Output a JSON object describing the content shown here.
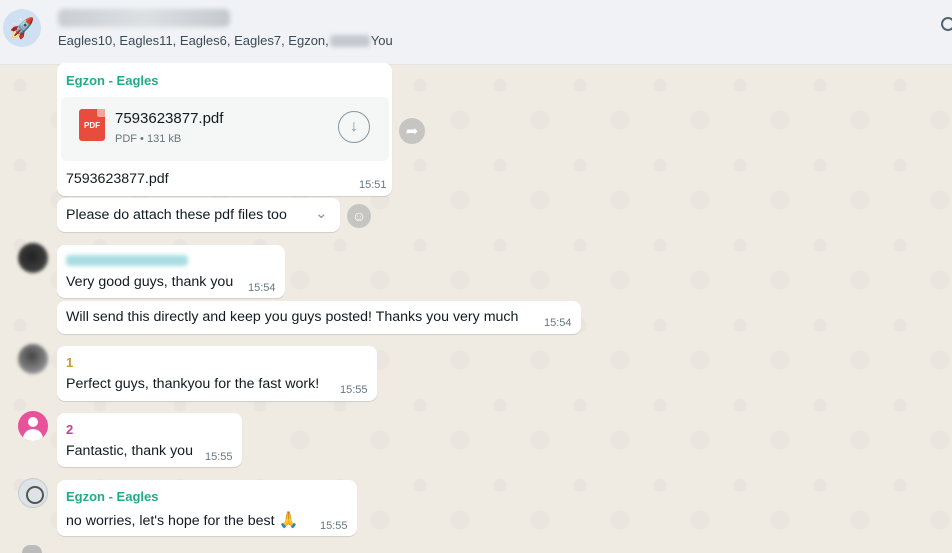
{
  "header": {
    "participants_prefix": "Eagles10, Eagles11, Eagles6, Eagles7, Egzon,",
    "participants_suffix": "You",
    "avatar_icon": "rocket-icon",
    "avatar_emoji": "🚀"
  },
  "messages": [
    {
      "sender": "Egzon - Eagles",
      "sender_color": "#25a98b",
      "document": {
        "name": "7593623877.pdf",
        "type_label": "PDF",
        "meta": "PDF • 131 kB"
      },
      "caption": "7593623877.pdf",
      "time": "15:51"
    },
    {
      "text": "Please do attach these pdf files too"
    },
    {
      "text": "Very good guys, thank you",
      "time": "15:54"
    },
    {
      "text": "Will send this directly and keep you guys posted! Thanks you very much",
      "time": "15:54"
    },
    {
      "sender": "1",
      "sender_color": "#c99a2e",
      "text": "Perfect guys, thankyou for the fast work!",
      "time": "15:55"
    },
    {
      "sender": "2",
      "sender_color": "#c0449f",
      "text": "Fantastic, thank you",
      "time": "15:55"
    },
    {
      "sender": "Egzon - Eagles",
      "sender_color": "#25a98b",
      "text": "no worries, let's hope for the best",
      "emoji": "🙏",
      "time": "15:55"
    }
  ],
  "icons": {
    "download": "↓",
    "forward": "➦",
    "chevron": "⌄",
    "smiley": "☺",
    "person": "●"
  }
}
